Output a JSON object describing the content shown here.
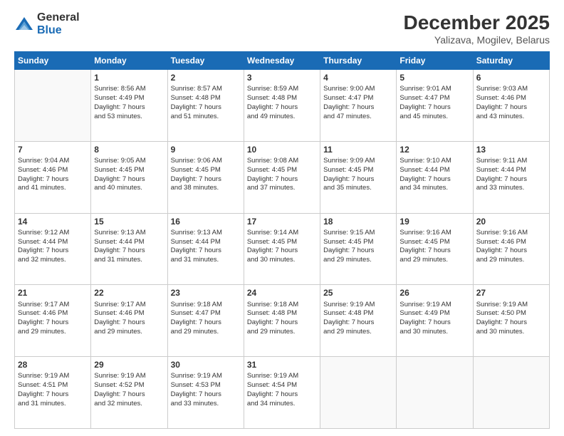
{
  "logo": {
    "general": "General",
    "blue": "Blue"
  },
  "title": "December 2025",
  "location": "Yalizava, Mogilev, Belarus",
  "weekdays": [
    "Sunday",
    "Monday",
    "Tuesday",
    "Wednesday",
    "Thursday",
    "Friday",
    "Saturday"
  ],
  "weeks": [
    [
      {
        "day": "",
        "info": ""
      },
      {
        "day": "1",
        "info": "Sunrise: 8:56 AM\nSunset: 4:49 PM\nDaylight: 7 hours\nand 53 minutes."
      },
      {
        "day": "2",
        "info": "Sunrise: 8:57 AM\nSunset: 4:48 PM\nDaylight: 7 hours\nand 51 minutes."
      },
      {
        "day": "3",
        "info": "Sunrise: 8:59 AM\nSunset: 4:48 PM\nDaylight: 7 hours\nand 49 minutes."
      },
      {
        "day": "4",
        "info": "Sunrise: 9:00 AM\nSunset: 4:47 PM\nDaylight: 7 hours\nand 47 minutes."
      },
      {
        "day": "5",
        "info": "Sunrise: 9:01 AM\nSunset: 4:47 PM\nDaylight: 7 hours\nand 45 minutes."
      },
      {
        "day": "6",
        "info": "Sunrise: 9:03 AM\nSunset: 4:46 PM\nDaylight: 7 hours\nand 43 minutes."
      }
    ],
    [
      {
        "day": "7",
        "info": "Sunrise: 9:04 AM\nSunset: 4:46 PM\nDaylight: 7 hours\nand 41 minutes."
      },
      {
        "day": "8",
        "info": "Sunrise: 9:05 AM\nSunset: 4:45 PM\nDaylight: 7 hours\nand 40 minutes."
      },
      {
        "day": "9",
        "info": "Sunrise: 9:06 AM\nSunset: 4:45 PM\nDaylight: 7 hours\nand 38 minutes."
      },
      {
        "day": "10",
        "info": "Sunrise: 9:08 AM\nSunset: 4:45 PM\nDaylight: 7 hours\nand 37 minutes."
      },
      {
        "day": "11",
        "info": "Sunrise: 9:09 AM\nSunset: 4:45 PM\nDaylight: 7 hours\nand 35 minutes."
      },
      {
        "day": "12",
        "info": "Sunrise: 9:10 AM\nSunset: 4:44 PM\nDaylight: 7 hours\nand 34 minutes."
      },
      {
        "day": "13",
        "info": "Sunrise: 9:11 AM\nSunset: 4:44 PM\nDaylight: 7 hours\nand 33 minutes."
      }
    ],
    [
      {
        "day": "14",
        "info": "Sunrise: 9:12 AM\nSunset: 4:44 PM\nDaylight: 7 hours\nand 32 minutes."
      },
      {
        "day": "15",
        "info": "Sunrise: 9:13 AM\nSunset: 4:44 PM\nDaylight: 7 hours\nand 31 minutes."
      },
      {
        "day": "16",
        "info": "Sunrise: 9:13 AM\nSunset: 4:44 PM\nDaylight: 7 hours\nand 31 minutes."
      },
      {
        "day": "17",
        "info": "Sunrise: 9:14 AM\nSunset: 4:45 PM\nDaylight: 7 hours\nand 30 minutes."
      },
      {
        "day": "18",
        "info": "Sunrise: 9:15 AM\nSunset: 4:45 PM\nDaylight: 7 hours\nand 29 minutes."
      },
      {
        "day": "19",
        "info": "Sunrise: 9:16 AM\nSunset: 4:45 PM\nDaylight: 7 hours\nand 29 minutes."
      },
      {
        "day": "20",
        "info": "Sunrise: 9:16 AM\nSunset: 4:46 PM\nDaylight: 7 hours\nand 29 minutes."
      }
    ],
    [
      {
        "day": "21",
        "info": "Sunrise: 9:17 AM\nSunset: 4:46 PM\nDaylight: 7 hours\nand 29 minutes."
      },
      {
        "day": "22",
        "info": "Sunrise: 9:17 AM\nSunset: 4:46 PM\nDaylight: 7 hours\nand 29 minutes."
      },
      {
        "day": "23",
        "info": "Sunrise: 9:18 AM\nSunset: 4:47 PM\nDaylight: 7 hours\nand 29 minutes."
      },
      {
        "day": "24",
        "info": "Sunrise: 9:18 AM\nSunset: 4:48 PM\nDaylight: 7 hours\nand 29 minutes."
      },
      {
        "day": "25",
        "info": "Sunrise: 9:19 AM\nSunset: 4:48 PM\nDaylight: 7 hours\nand 29 minutes."
      },
      {
        "day": "26",
        "info": "Sunrise: 9:19 AM\nSunset: 4:49 PM\nDaylight: 7 hours\nand 30 minutes."
      },
      {
        "day": "27",
        "info": "Sunrise: 9:19 AM\nSunset: 4:50 PM\nDaylight: 7 hours\nand 30 minutes."
      }
    ],
    [
      {
        "day": "28",
        "info": "Sunrise: 9:19 AM\nSunset: 4:51 PM\nDaylight: 7 hours\nand 31 minutes."
      },
      {
        "day": "29",
        "info": "Sunrise: 9:19 AM\nSunset: 4:52 PM\nDaylight: 7 hours\nand 32 minutes."
      },
      {
        "day": "30",
        "info": "Sunrise: 9:19 AM\nSunset: 4:53 PM\nDaylight: 7 hours\nand 33 minutes."
      },
      {
        "day": "31",
        "info": "Sunrise: 9:19 AM\nSunset: 4:54 PM\nDaylight: 7 hours\nand 34 minutes."
      },
      {
        "day": "",
        "info": ""
      },
      {
        "day": "",
        "info": ""
      },
      {
        "day": "",
        "info": ""
      }
    ]
  ]
}
